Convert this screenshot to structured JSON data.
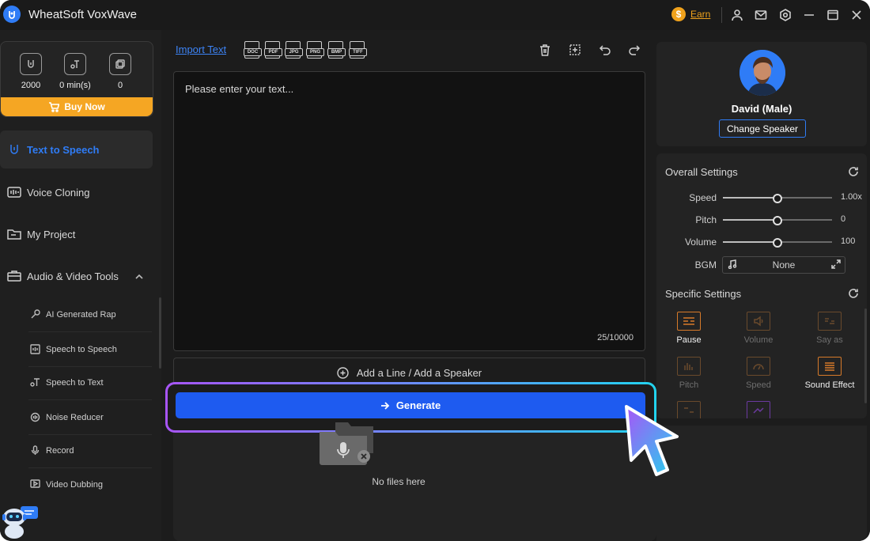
{
  "app": {
    "title": "WheatSoft VoxWave"
  },
  "titlebar": {
    "earn_coin": "$",
    "earn_label": "Earn"
  },
  "stats": [
    {
      "icon": "character-icon",
      "value": "2000"
    },
    {
      "icon": "time-icon",
      "value": "0 min(s)"
    },
    {
      "icon": "clone-voice-icon",
      "value": "0"
    }
  ],
  "buy_now": "Buy Now",
  "nav": [
    {
      "label": "Text to Speech",
      "icon": "microphone-icon",
      "active": true
    },
    {
      "label": "Voice Cloning",
      "icon": "waveform-icon"
    },
    {
      "label": "My Project",
      "icon": "folder-icon"
    },
    {
      "label": "Audio & Video Tools",
      "icon": "toolbox-icon",
      "expanded": true
    }
  ],
  "tools": [
    {
      "label": "AI Generated Rap",
      "icon": "rap-mic-icon"
    },
    {
      "label": "Speech to Speech",
      "icon": "speech-icon"
    },
    {
      "label": "Speech to Text",
      "icon": "transcribe-icon"
    },
    {
      "label": "Noise Reducer",
      "icon": "noise-icon"
    },
    {
      "label": "Record",
      "icon": "record-icon"
    },
    {
      "label": "Video Dubbing",
      "icon": "dubbing-icon"
    }
  ],
  "editor": {
    "import_text": "Import Text",
    "file_types": [
      "DOC",
      "PDF",
      "JPG",
      "PNG",
      "BMP",
      "TIFF"
    ],
    "placeholder": "Please enter your text...",
    "char_count": "25/10000",
    "add_line": "Add a Line / Add a Speaker",
    "generate": "Generate"
  },
  "files": {
    "empty_text": "No files here"
  },
  "speaker": {
    "name": "David (Male)",
    "change_label": "Change Speaker"
  },
  "overall_settings": {
    "title": "Overall Settings",
    "sliders": [
      {
        "label": "Speed",
        "value": "1.00x",
        "level": 0.5
      },
      {
        "label": "Pitch",
        "value": "0",
        "level": 0.5
      },
      {
        "label": "Volume",
        "value": "100",
        "level": 0.5
      }
    ],
    "bgm_label": "BGM",
    "bgm_value": "None"
  },
  "specific_settings": {
    "title": "Specific Settings",
    "tiles": [
      {
        "label": "Pause",
        "state": "on"
      },
      {
        "label": "Volume",
        "state": "off"
      },
      {
        "label": "Say as",
        "state": "off"
      },
      {
        "label": "Pitch",
        "state": "off"
      },
      {
        "label": "Speed",
        "state": "off"
      },
      {
        "label": "Sound Effect",
        "state": "on"
      }
    ]
  },
  "colors": {
    "accent": "#2f7cf6",
    "buy": "#f5a623",
    "tile": "#d77a2a",
    "generate": "#1e5bf0"
  }
}
